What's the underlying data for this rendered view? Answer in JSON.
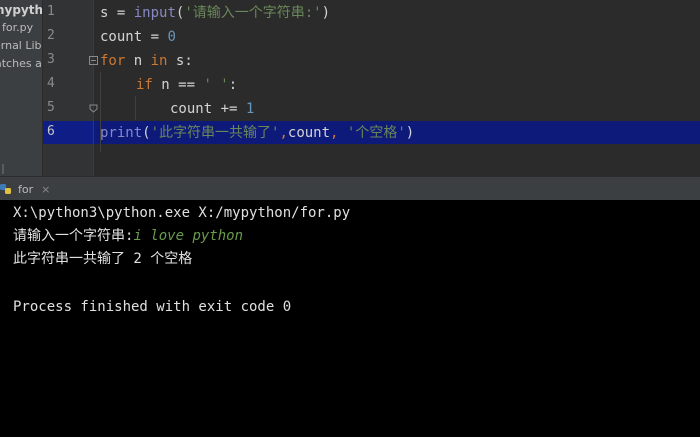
{
  "project": {
    "root_label": "mypython",
    "file_label": "for.py",
    "external_label": "ernal Lib",
    "scratches_label": "atches a"
  },
  "editor": {
    "line_numbers": [
      "1",
      "2",
      "3",
      "4",
      "5",
      "6"
    ],
    "current_line": "6",
    "lines": {
      "l1": {
        "var": "s",
        "op": " = ",
        "fn": "input",
        "open": "(",
        "str": "'请输入一个字符串:'",
        "close": ")"
      },
      "l2": {
        "var": "count",
        "op": " = ",
        "num": "0"
      },
      "l3": {
        "kw1": "for",
        "sp1": " ",
        "var": "n",
        "sp2": " ",
        "kw2": "in",
        "rest": " s:"
      },
      "l4": {
        "kw": "if",
        "rest": " n == ",
        "str": "' '",
        "colon": ":"
      },
      "l5": {
        "var": "count",
        "op": " += ",
        "num": "1"
      },
      "l6": {
        "fn": "print",
        "open": "(",
        "str1": "'此字符串一共输了'",
        "comma1": ",",
        "var": "count",
        "comma2": ", ",
        "str2": "'个空格'",
        "close": ")"
      }
    }
  },
  "run_window": {
    "tab_label": "for",
    "close_glyph": "×",
    "icon": "python-run-icon"
  },
  "console": {
    "command": "X:\\python3\\python.exe X:/mypython/for.py",
    "prompt": "请输入一个字符串:",
    "user_input": "i love python",
    "result": "此字符串一共输了 2 个空格",
    "exit_message": "Process finished with exit code 0"
  }
}
